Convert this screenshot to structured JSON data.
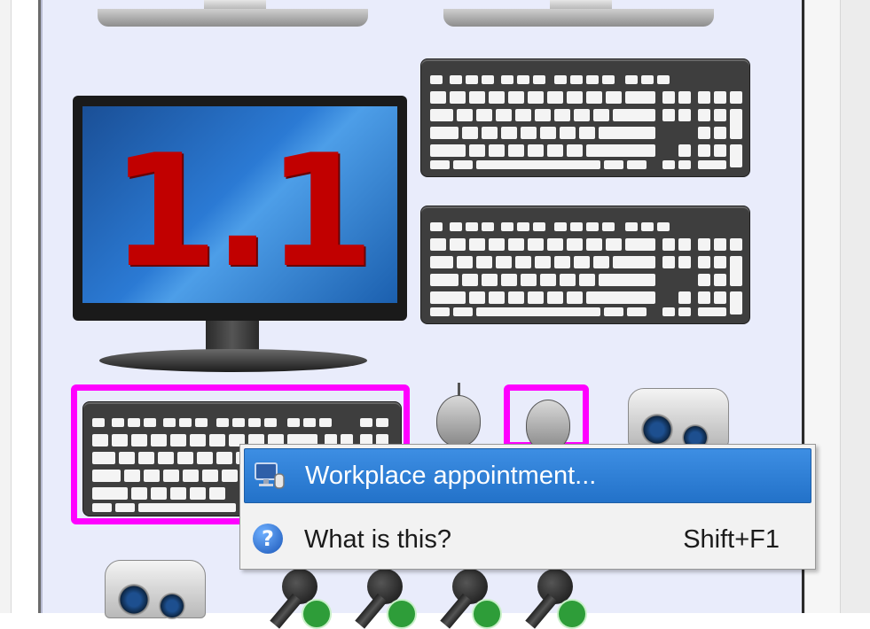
{
  "monitor": {
    "display_text": "1.1"
  },
  "context_menu": {
    "items": [
      {
        "label": "Workplace appointment...",
        "shortcut": "",
        "icon": "workplace-icon",
        "highlighted": true
      },
      {
        "label": "What is this?",
        "shortcut": "Shift+F1",
        "icon": "help-icon",
        "highlighted": false
      }
    ]
  },
  "colors": {
    "selection": "#ff00ff",
    "canvas_bg": "#e9ecfb",
    "menu_highlight": "#2a7fd8",
    "monitor_text": "#c10000"
  }
}
